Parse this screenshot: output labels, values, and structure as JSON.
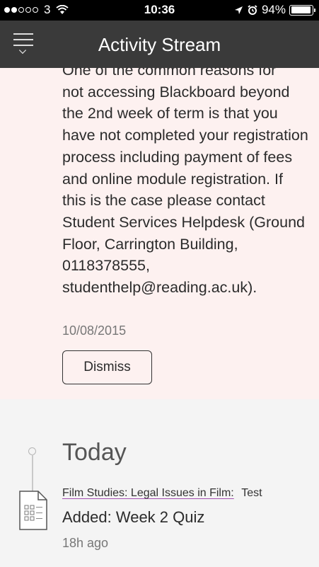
{
  "status_bar": {
    "carrier": "3",
    "time": "10:36",
    "battery": "94%",
    "battery_level": 0.94,
    "signal_bars_filled": 2,
    "signal_bars_total": 5
  },
  "nav": {
    "title": "Activity Stream",
    "menu_icon": "hamburger-chevron-icon"
  },
  "notice": {
    "text_partial_top": "One of the common reasons for",
    "text": "not accessing Blackboard beyond the 2nd week of term is that you have not completed your registration process including payment of fees and online module registration. If this is the case please contact Student Services Helpdesk (Ground Floor, Carrington Building, 0118378555, studenthelp@reading.ac.uk).",
    "date": "10/08/2015",
    "dismiss_label": "Dismiss",
    "background": "#fdf1f0"
  },
  "stream": {
    "section_heading": "Today",
    "items": [
      {
        "course": "Film Studies: Legal Issues in Film:",
        "type": "Test",
        "title": "Added: Week 2 Quiz",
        "time": "18h ago",
        "icon": "document-test-icon"
      }
    ]
  },
  "colors": {
    "nav_bar": "#3a3a3a",
    "link_underline": "#a24fb1"
  }
}
